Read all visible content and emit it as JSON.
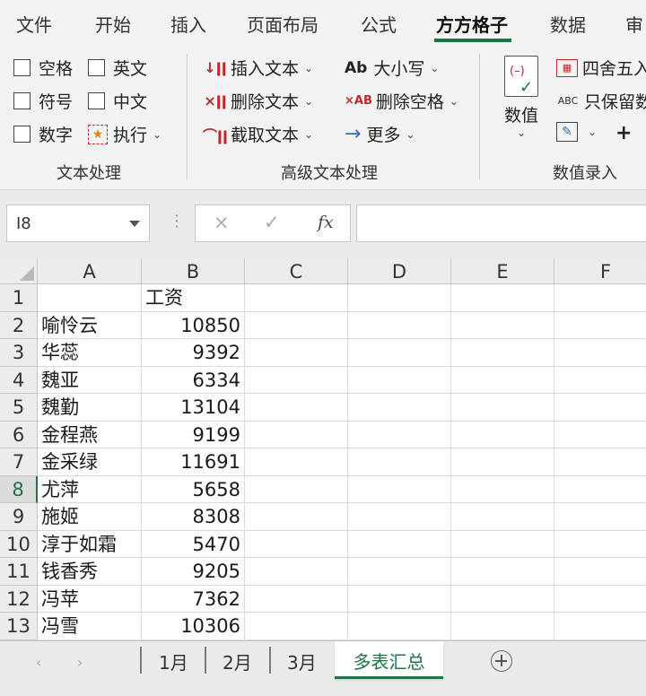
{
  "menu": {
    "tabs": [
      "文件",
      "开始",
      "插入",
      "页面布局",
      "公式",
      "方方格子",
      "数据",
      "审"
    ],
    "active": "方方格子"
  },
  "ribbon": {
    "text_group": {
      "label": "文本处理",
      "checkboxes": [
        "空格",
        "英文",
        "符号",
        "中文",
        "数字"
      ],
      "execute_label": "执行"
    },
    "advanced_group": {
      "label": "高级文本处理",
      "insert_text": "插入文本",
      "delete_text": "删除文本",
      "extract_text": "截取文本",
      "case_label": "大小写",
      "case_icon_text": "Ab",
      "delete_spaces": "删除空格",
      "delete_spaces_icon_text": "×AB",
      "more": "更多"
    },
    "number_group": {
      "label": "数值录入",
      "value_button": "数值",
      "round": "四舍五入",
      "keep_numbers": "只保留数",
      "keep_icon_text": "ABC"
    }
  },
  "formula_bar": {
    "name_box": "I8",
    "cancel_icon": "×",
    "enter_icon": "✓",
    "fx_label": "fx",
    "formula": ""
  },
  "columns": [
    "A",
    "B",
    "C",
    "D",
    "E",
    "F"
  ],
  "rows": [
    {
      "num": "1",
      "a": "",
      "b": "工资"
    },
    {
      "num": "2",
      "a": "喻怜云",
      "b": "10850"
    },
    {
      "num": "3",
      "a": "华蕊",
      "b": "9392"
    },
    {
      "num": "4",
      "a": "魏亚",
      "b": "6334"
    },
    {
      "num": "5",
      "a": "魏勤",
      "b": "13104"
    },
    {
      "num": "6",
      "a": "金程燕",
      "b": "9199"
    },
    {
      "num": "7",
      "a": "金采绿",
      "b": "11691"
    },
    {
      "num": "8",
      "a": "尤萍",
      "b": "5658"
    },
    {
      "num": "9",
      "a": "施姬",
      "b": "8308"
    },
    {
      "num": "10",
      "a": "淳于如霜",
      "b": "5470"
    },
    {
      "num": "11",
      "a": "钱香秀",
      "b": "9205"
    },
    {
      "num": "12",
      "a": "冯苹",
      "b": "7362"
    },
    {
      "num": "13",
      "a": "冯雪",
      "b": "10306"
    }
  ],
  "selected_row": "8",
  "sheets": {
    "tabs": [
      "1月",
      "2月",
      "3月"
    ],
    "active": "多表汇总"
  },
  "colors": {
    "accent": "#217346",
    "ribbon_bg": "#f3f3f3",
    "red_icon": "#c0282c",
    "blue_icon": "#2f6dc4"
  }
}
